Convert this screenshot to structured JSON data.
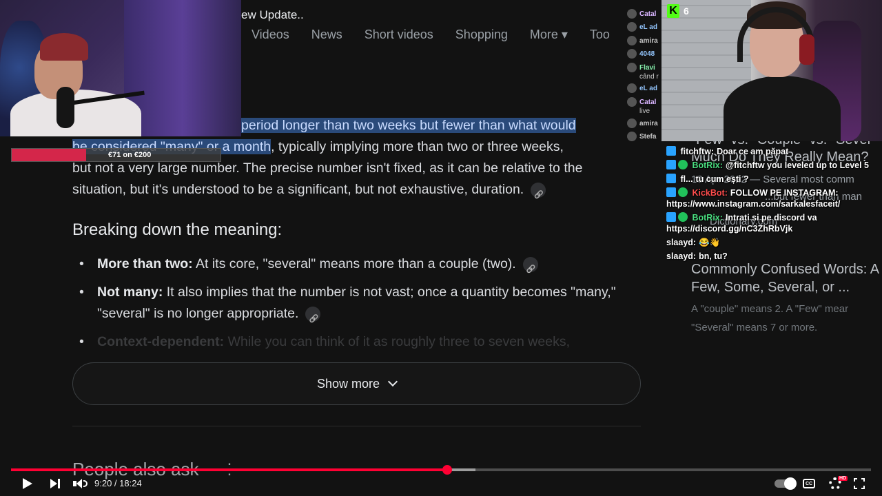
{
  "video": {
    "title_fragment": "ew Update..",
    "current_time": "9:20",
    "duration": "18:24",
    "time_display": "9:20 / 18:24",
    "played_fraction": 0.507,
    "buffered_fraction": 0.54
  },
  "search_tabs": [
    "Videos",
    "News",
    "Short videos",
    "Shopping",
    "More ▾",
    "Too"
  ],
  "answer": {
    "line1_highlight": "period longer than two weeks but fewer than what would",
    "line2_highlight": "be considered \"many\" or a month",
    "line2_rest": ", typically implying more than two or three weeks,",
    "line3": "but not a very large number. The precise number isn't fixed, as it can be relative to the",
    "line4": "situation, but it's understood to be a significant, but not exhaustive, duration."
  },
  "section_heading": "Breaking down the meaning:",
  "points": [
    {
      "term": "More than two:",
      "text": " At its core, \"several\" means more than a couple (two)."
    },
    {
      "term": "Not many:",
      "text": " It also implies that the number is not vast; once a quantity becomes \"many,\" \"several\" is no longer appropriate."
    },
    {
      "term": "Context-dependent:",
      "text": " While you can think of it as roughly three to seven weeks,"
    }
  ],
  "show_more_label": "Show more",
  "people_also_ask": "People also ask",
  "right_panel": {
    "title1": "Much Do They Really Mean?",
    "title0": "\"Few\" vs. \"Couple\" vs. \"Sever",
    "date_snippet": "12 Apr 2022 — Several most comm",
    "snippet2": "...but fewer than man",
    "source": "Dictionary.com",
    "title2a": "Commonly Confused Words: A",
    "title2b": "Few, Some, Several, or ...",
    "desc1": "A \"couple\" means 2. A \"Few\" mear",
    "desc2": "\"Several\" means 7 or more."
  },
  "kick_viewers": "6",
  "goal": {
    "text": "€71 on €200",
    "fraction": 0.355
  },
  "mini_chat": [
    {
      "name": "Catal",
      "color": "#d8b4fe"
    },
    {
      "name": "eL ad",
      "color": "#93c5fd"
    },
    {
      "name": "amira",
      "color": "#e5e7eb"
    },
    {
      "name": "4048",
      "color": "#93c5fd"
    },
    {
      "name": "Flavi",
      "color": "#86efac"
    },
    {
      "name": "când r",
      "color": "#e5e7eb"
    },
    {
      "name": "eL ad",
      "color": "#93c5fd"
    },
    {
      "name": "Catal",
      "color": "#d8b4fe"
    },
    {
      "name": "live",
      "color": "#e5e7eb"
    },
    {
      "name": "amira",
      "color": "#e5e7eb"
    },
    {
      "name": "Stefa",
      "color": "#e5e7eb"
    }
  ],
  "chat": [
    {
      "user": "fitchftw:",
      "user_color": "#ffffff",
      "text": "Doar ce am păpat",
      "badges": [
        "kick"
      ]
    },
    {
      "user": "BotRix:",
      "user_color": "#4ade80",
      "text": "@fitchftw you leveled up to Level 5",
      "badges": [
        "kick",
        "verified"
      ]
    },
    {
      "user": "fl...",
      "user_color": "#ffffff",
      "text": "tu cum ești ?",
      "badges": [
        "kick"
      ]
    },
    {
      "user": "KickBot:",
      "user_color": "#ff4d4d",
      "text": "FOLLOW PE INSTAGRAM: https://www.instagram.com/sarkalesfaceit/",
      "badges": [
        "kick",
        "verified"
      ]
    },
    {
      "user": "BotRix:",
      "user_color": "#4ade80",
      "text": "Intrati si pe discord va https://discord.gg/nC3ZhRbVjk",
      "badges": [
        "kick",
        "verified"
      ]
    },
    {
      "user": "slaayd:",
      "user_color": "#e5e7eb",
      "text": "😂👋",
      "badges": []
    },
    {
      "user": "slaayd:",
      "user_color": "#e5e7eb",
      "text": "bn, tu?",
      "badges": []
    }
  ],
  "colors": {
    "accent": "#ff0033",
    "highlight_bg": "#2a4a7a",
    "kick_green": "#53fc18"
  }
}
